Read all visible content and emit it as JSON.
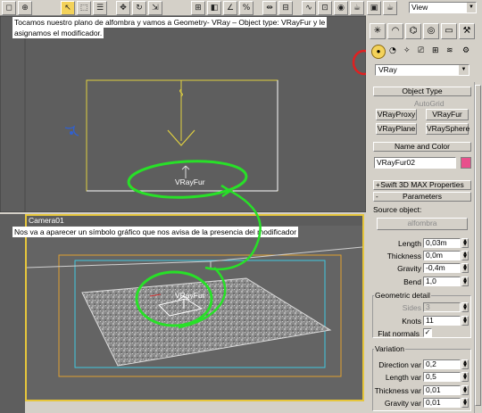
{
  "toolbar": {
    "view_dropdown": "View",
    "buttons": [
      "select-icon",
      "zoom-icon",
      "pan-icon",
      "rotate-icon",
      "scale-icon",
      "snap-icon",
      "angle-snap-icon",
      "percent-snap-icon",
      "mirror-icon",
      "align-icon",
      "layers-icon",
      "curve-editor-icon",
      "schematic-icon",
      "material-editor-icon",
      "render-icon"
    ]
  },
  "captions": {
    "top": "Tocamos nuestro plano de alfombra y vamos a Geometry- VRay – Object type: VRayFur y le asignamos el modificador.",
    "top_line1": "Tocamos nuestro plano de alfombra y vamos a Geometry- VRay – Object type: VRayFur y le",
    "top_line2": "asignamos el modificador.",
    "bottom": "Nos va a aparecer un símbolo gráfico que nos avisa de la presencia del modificador"
  },
  "viewport_top": {
    "object_label": "VRayFur"
  },
  "viewport_camera": {
    "title": "Camera01",
    "object_label": "VRayFur"
  },
  "panel": {
    "tabs": [
      "create-tab",
      "modify-tab",
      "hierarchy-tab",
      "motion-tab",
      "display-tab",
      "utilities-tab"
    ],
    "category_dropdown": "VRay",
    "object_type": {
      "title": "Object Type",
      "autogrid": "AutoGrid",
      "buttons": [
        "VRayProxy",
        "VRayFur",
        "VRayPlane",
        "VRaySphere"
      ]
    },
    "name_and_color": {
      "title": "Name and Color",
      "name": "VRayFur02",
      "color": "#e8508c"
    },
    "swift": {
      "title": "Swift 3D MAX Properties"
    },
    "parameters": {
      "title": "Parameters",
      "source_label": "Source object:",
      "source_button": "alfombra",
      "length_label": "Length",
      "length": "0,03m",
      "thickness_label": "Thickness",
      "thickness": "0,0m",
      "gravity_label": "Gravity",
      "gravity": "-0,4m",
      "bend_label": "Bend",
      "bend": "1,0",
      "geometric_detail": {
        "title": "Geometric detail",
        "sides_label": "Sides",
        "sides": "3",
        "knots_label": "Knots",
        "knots": "11",
        "flat_normals_label": "Flat normals",
        "flat_normals": true
      },
      "variation": {
        "title": "Variation",
        "direction_label": "Direction var",
        "direction": "0,2",
        "length_var_label": "Length var",
        "length_var": "0,5",
        "thickness_var_label": "Thickness var",
        "thickness_var": "0,01",
        "gravity_var_label": "Gravity var",
        "gravity_var": "0,01"
      }
    }
  },
  "colors": {
    "annotation_green": "#28e028",
    "annotation_red": "#e02020",
    "selected": "#f3d25a",
    "viewport_gray": "#5e5e5e"
  }
}
